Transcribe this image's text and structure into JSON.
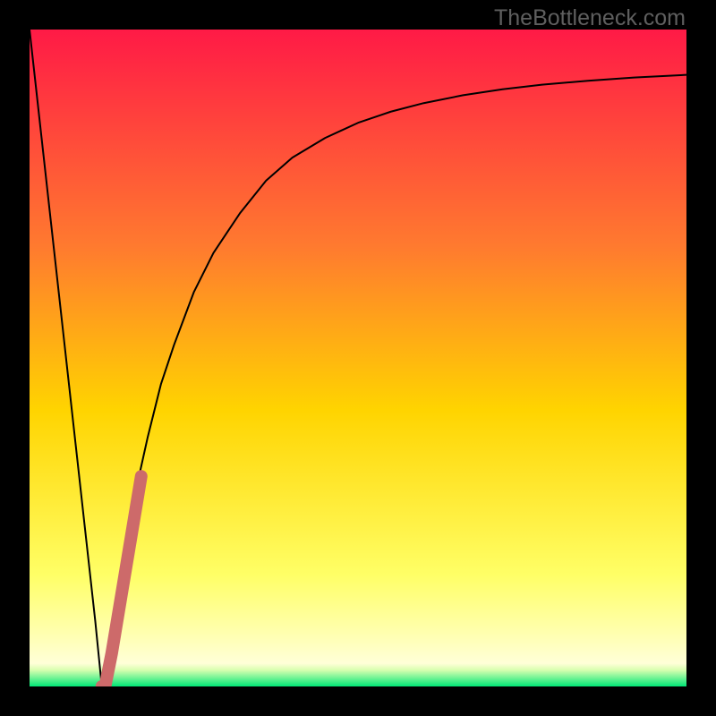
{
  "attribution": "TheBottleneck.com",
  "colors": {
    "gradient_top": "#ff1a46",
    "gradient_mid_upper": "#ff7a2f",
    "gradient_mid": "#ffd400",
    "gradient_lower": "#ffff66",
    "gradient_pale": "#ffffb0",
    "gradient_green": "#00e676",
    "curve": "#000000",
    "accent_stroke": "#cd6a6a",
    "frame": "#000000"
  },
  "chart_data": {
    "type": "line",
    "title": "",
    "xlabel": "",
    "ylabel": "",
    "xlim": [
      0,
      100
    ],
    "ylim": [
      0,
      100
    ],
    "series": [
      {
        "name": "bottleneck-curve",
        "x": [
          0,
          2,
          4,
          6,
          8,
          10,
          11,
          12,
          14,
          16,
          18,
          20,
          22,
          25,
          28,
          32,
          36,
          40,
          45,
          50,
          55,
          60,
          66,
          72,
          78,
          85,
          92,
          100
        ],
        "values": [
          100,
          82,
          64,
          46,
          28,
          10,
          0,
          6,
          18,
          29,
          38,
          46,
          52,
          60,
          66,
          72,
          77,
          80.5,
          83.5,
          85.8,
          87.5,
          88.8,
          90,
          90.9,
          91.6,
          92.2,
          92.7,
          93.1
        ]
      },
      {
        "name": "accent-segment",
        "x": [
          11,
          11.5,
          12.5,
          14,
          15.5,
          17
        ],
        "values": [
          0,
          0,
          5,
          14,
          23,
          32
        ]
      }
    ],
    "annotations": []
  }
}
